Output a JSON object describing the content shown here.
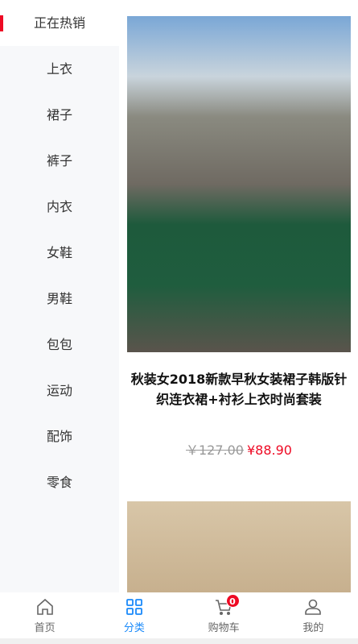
{
  "sidebar": {
    "items": [
      {
        "label": "正在热销",
        "active": true
      },
      {
        "label": "上衣"
      },
      {
        "label": "裙子"
      },
      {
        "label": "裤子"
      },
      {
        "label": "内衣"
      },
      {
        "label": "女鞋"
      },
      {
        "label": "男鞋"
      },
      {
        "label": "包包"
      },
      {
        "label": "运动"
      },
      {
        "label": "配饰"
      },
      {
        "label": "零食"
      }
    ]
  },
  "products": [
    {
      "title": "秋装女2018新款早秋女装裙子韩版针织连衣裙+衬衫上衣时尚套装",
      "original_price": "￥127.00",
      "price": "¥88.90"
    }
  ],
  "tabbar": {
    "items": [
      {
        "label": "首页",
        "icon": "home-icon"
      },
      {
        "label": "分类",
        "icon": "category-icon",
        "active": true
      },
      {
        "label": "购物车",
        "icon": "cart-icon",
        "badge": "0"
      },
      {
        "label": "我的",
        "icon": "user-icon"
      }
    ]
  },
  "colors": {
    "accent": "#1989fa",
    "danger": "#ee0a24"
  }
}
